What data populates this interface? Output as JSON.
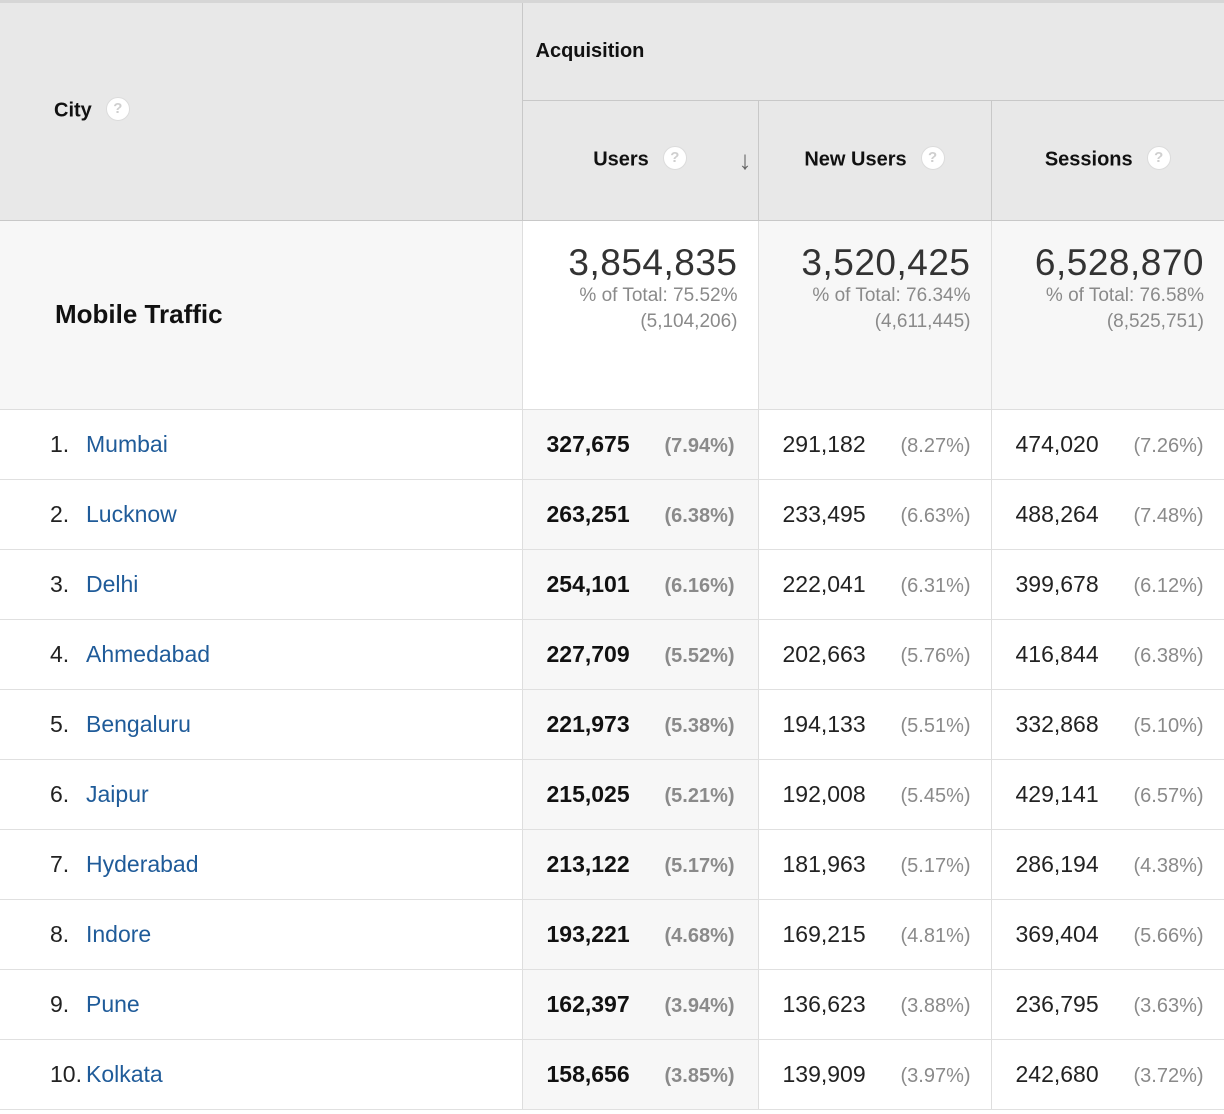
{
  "header": {
    "dimension_label": "City",
    "group_label": "Acquisition",
    "columns": [
      {
        "label": "Users"
      },
      {
        "label": "New Users"
      },
      {
        "label": "Sessions"
      }
    ],
    "help_glyph": "?",
    "sort_glyph": "↓"
  },
  "totals": {
    "label": "Mobile Traffic",
    "users": {
      "value": "3,854,835",
      "pct": "% of Total: 75.52%",
      "abs": "(5,104,206)"
    },
    "new_users": {
      "value": "3,520,425",
      "pct": "% of Total: 76.34%",
      "abs": "(4,611,445)"
    },
    "sessions": {
      "value": "6,528,870",
      "pct": "% of Total: 76.58%",
      "abs": "(8,525,751)"
    }
  },
  "rows": [
    {
      "rank": "1.",
      "city": "Mumbai",
      "users": "327,675",
      "users_pct": "(7.94%)",
      "new_users": "291,182",
      "new_users_pct": "(8.27%)",
      "sessions": "474,020",
      "sessions_pct": "(7.26%)"
    },
    {
      "rank": "2.",
      "city": "Lucknow",
      "users": "263,251",
      "users_pct": "(6.38%)",
      "new_users": "233,495",
      "new_users_pct": "(6.63%)",
      "sessions": "488,264",
      "sessions_pct": "(7.48%)"
    },
    {
      "rank": "3.",
      "city": "Delhi",
      "users": "254,101",
      "users_pct": "(6.16%)",
      "new_users": "222,041",
      "new_users_pct": "(6.31%)",
      "sessions": "399,678",
      "sessions_pct": "(6.12%)"
    },
    {
      "rank": "4.",
      "city": "Ahmedabad",
      "users": "227,709",
      "users_pct": "(5.52%)",
      "new_users": "202,663",
      "new_users_pct": "(5.76%)",
      "sessions": "416,844",
      "sessions_pct": "(6.38%)"
    },
    {
      "rank": "5.",
      "city": "Bengaluru",
      "users": "221,973",
      "users_pct": "(5.38%)",
      "new_users": "194,133",
      "new_users_pct": "(5.51%)",
      "sessions": "332,868",
      "sessions_pct": "(5.10%)"
    },
    {
      "rank": "6.",
      "city": "Jaipur",
      "users": "215,025",
      "users_pct": "(5.21%)",
      "new_users": "192,008",
      "new_users_pct": "(5.45%)",
      "sessions": "429,141",
      "sessions_pct": "(6.57%)"
    },
    {
      "rank": "7.",
      "city": "Hyderabad",
      "users": "213,122",
      "users_pct": "(5.17%)",
      "new_users": "181,963",
      "new_users_pct": "(5.17%)",
      "sessions": "286,194",
      "sessions_pct": "(4.38%)"
    },
    {
      "rank": "8.",
      "city": "Indore",
      "users": "193,221",
      "users_pct": "(4.68%)",
      "new_users": "169,215",
      "new_users_pct": "(4.81%)",
      "sessions": "369,404",
      "sessions_pct": "(5.66%)"
    },
    {
      "rank": "9.",
      "city": "Pune",
      "users": "162,397",
      "users_pct": "(3.94%)",
      "new_users": "136,623",
      "new_users_pct": "(3.88%)",
      "sessions": "236,795",
      "sessions_pct": "(3.63%)"
    },
    {
      "rank": "10.",
      "city": "Kolkata",
      "users": "158,656",
      "users_pct": "(3.85%)",
      "new_users": "139,909",
      "new_users_pct": "(3.97%)",
      "sessions": "242,680",
      "sessions_pct": "(3.72%)"
    }
  ],
  "colors": {
    "link": "#1f5b99",
    "header_bg": "#e8e8e8",
    "muted_text": "#8a8a8a"
  }
}
